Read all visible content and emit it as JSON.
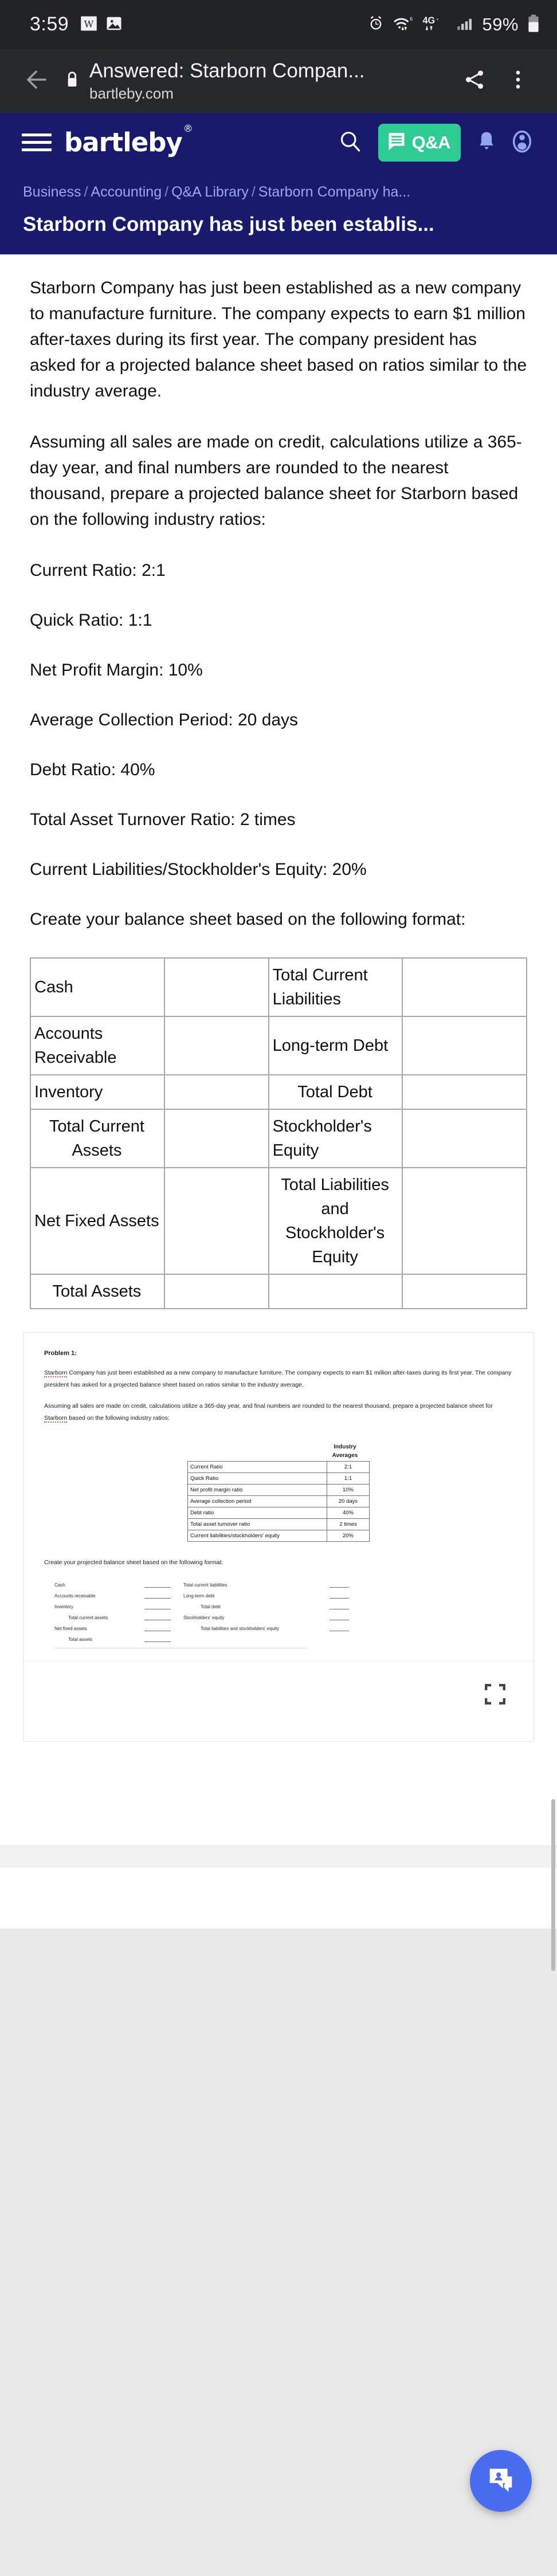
{
  "status_bar": {
    "clock": "3:59",
    "left_icons": [
      "wikipedia-icon",
      "image-icon"
    ],
    "right_icons": [
      "alarm-icon",
      "wifi-icon",
      "4g-signal-icon",
      "cell-signal-icon"
    ],
    "battery_text": "59%",
    "battery_icon": "battery-icon"
  },
  "browser": {
    "back_icon": "back-arrow-icon",
    "lock_icon": "lock-icon",
    "title": "Answered: Starborn Compan...",
    "url": "bartleby.com",
    "share_icon": "share-icon",
    "menu_icon": "more-vertical-icon"
  },
  "site_header": {
    "menu_icon": "hamburger-icon",
    "brand": "bartleby",
    "brand_mark": "®",
    "search_icon": "search-icon",
    "qa_label": "Q&A",
    "qa_icon": "chat-lines-icon",
    "bell_icon": "bell-icon",
    "avatar_icon": "user-avatar-icon",
    "accent_green": "#2ecc94",
    "header_navy": "#191a6e"
  },
  "breadcrumb": {
    "items": [
      "Business",
      "Accounting",
      "Q&A Library",
      "Starborn Company ha..."
    ],
    "separator": "/"
  },
  "page": {
    "title": "Starborn Company has just been establis..."
  },
  "question": {
    "paragraphs": [
      "Starborn Company has just been established as a new company to manufacture furniture. The company expects to earn $1 million after-taxes during its first year. The company president has asked for a projected balance sheet based on ratios similar to the industry average.",
      "Assuming all sales are made on credit, calculations utilize a 365-day year, and final numbers are rounded to the nearest thousand, prepare a projected balance sheet for Starborn based on the following industry ratios:"
    ],
    "ratios": [
      "Current Ratio: 2:1",
      "Quick Ratio: 1:1",
      "Net Profit Margin: 10%",
      "Average Collection Period: 20 days",
      "Debt Ratio: 40%",
      "Total Asset Turnover Ratio: 2 times",
      "Current Liabilities/Stockholder's Equity: 20%"
    ],
    "format_lead": "Create your balance sheet based on the following format:"
  },
  "balance_sheet_table": {
    "rows": [
      {
        "asset": "Cash",
        "asset_value": "",
        "liability": "Total Current Liabilities",
        "liability_value": "",
        "asset_center": false,
        "liability_center": false
      },
      {
        "asset": "Accounts Receivable",
        "asset_value": "",
        "liability": "Long-term Debt",
        "liability_value": "",
        "asset_center": false,
        "liability_center": false
      },
      {
        "asset": "Inventory",
        "asset_value": "",
        "liability": "Total Debt",
        "liability_value": "",
        "asset_center": false,
        "liability_center": true
      },
      {
        "asset": "Total Current Assets",
        "asset_value": "",
        "liability": "Stockholder's Equity",
        "liability_value": "",
        "asset_center": true,
        "liability_center": false
      },
      {
        "asset": "Net Fixed Assets",
        "asset_value": "",
        "liability": "Total Liabilities and Stockholder's Equity",
        "liability_value": "",
        "asset_center": false,
        "liability_center": true
      },
      {
        "asset": "Total Assets",
        "asset_value": "",
        "liability": "",
        "liability_value": "",
        "asset_center": true,
        "liability_center": false
      }
    ]
  },
  "scan": {
    "heading": "Problem 1:",
    "paragraph1_pre": "",
    "paragraph1_name": "Starborn",
    "paragraph1_rest": " Company has just been established as a new company to manufacture furniture. The company expects to earn $1 million after-taxes during its first year. The company president has asked for a projected balance sheet based on ratios similar to the industry average.",
    "paragraph2_pre": "Assuming all sales are made on credit, calculations utilize a 365-day year, and final numbers are rounded to the nearest thousand, prepare a projected balance sheet for ",
    "paragraph2_name": "Starborn",
    "paragraph2_rest": " based on the following industry ratios:",
    "averages_header_line1": "Industry",
    "averages_header_line2": "Averages",
    "averages_rows": [
      {
        "label": "Current Ratio",
        "value": "2:1"
      },
      {
        "label": "Quick Ratio",
        "value": "1:1"
      },
      {
        "label": "Net profit margin ratio",
        "value": "10%"
      },
      {
        "label": "Average collection period",
        "value": "20 days"
      },
      {
        "label": "Debt ratio",
        "value": "40%"
      },
      {
        "label": "Total asset turnover ratio",
        "value": "2 times"
      },
      {
        "label": "Current liabilities/stockholders' equity",
        "value": "20%"
      }
    ],
    "format_lead": "Create your projected balance sheet based on the following format:",
    "mini_rows": [
      {
        "left": "Cash",
        "left_indent": false,
        "right": "Total current liabilities",
        "right_indent": false
      },
      {
        "left": "Accounts receivable",
        "left_indent": false,
        "right": "Long-term debt",
        "right_indent": false
      },
      {
        "left": "Inventory",
        "left_indent": false,
        "right": "Total debt",
        "right_indent": true
      },
      {
        "left": "Total current assets",
        "left_indent": true,
        "right": "Stockholders' equity",
        "right_indent": false
      },
      {
        "left": "Net fixed assets",
        "left_indent": false,
        "right": "Total liabilities and stockholders' equity",
        "right_indent": true
      },
      {
        "left": "Total assets",
        "left_indent": true,
        "right": "",
        "right_indent": false
      }
    ],
    "expand_icon": "expand-fullscreen-icon"
  },
  "fab": {
    "icon": "ask-expert-chat-icon",
    "color": "#4a6cf0"
  }
}
